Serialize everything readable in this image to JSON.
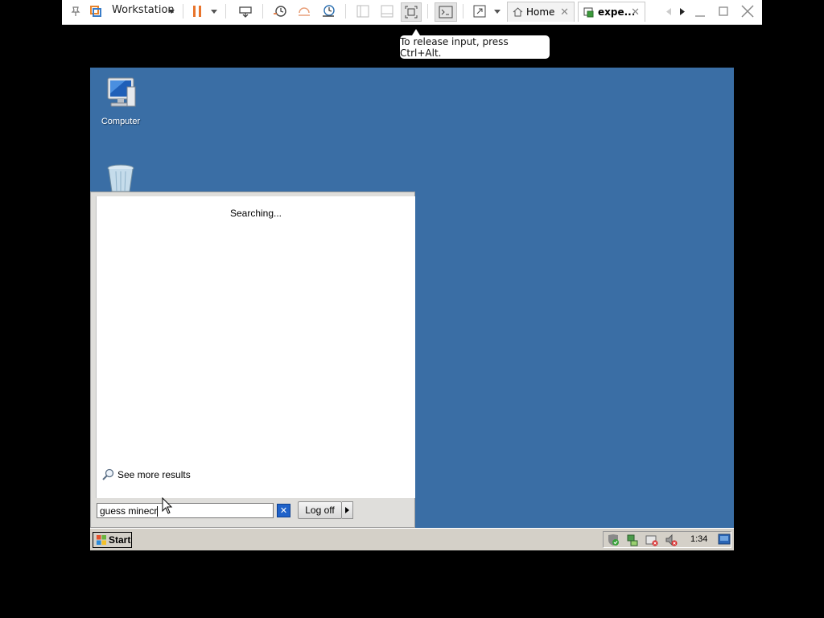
{
  "vmware": {
    "product_label": "Workstation",
    "tabs": [
      {
        "label": "Home"
      },
      {
        "label": "expe..."
      }
    ],
    "tooltip": "To release input, press Ctrl+Alt."
  },
  "desktop": {
    "icons": [
      {
        "label": "Computer",
        "icon": "computer-icon"
      },
      {
        "label": "",
        "icon": "recycle-bin-icon"
      }
    ],
    "background": "#3a6ea5"
  },
  "start_menu": {
    "status_text": "Searching...",
    "see_more_label": "See more results",
    "search_value": "guess minecr",
    "logoff_label": "Log off"
  },
  "taskbar": {
    "start_label": "Start",
    "clock": "1:34"
  }
}
